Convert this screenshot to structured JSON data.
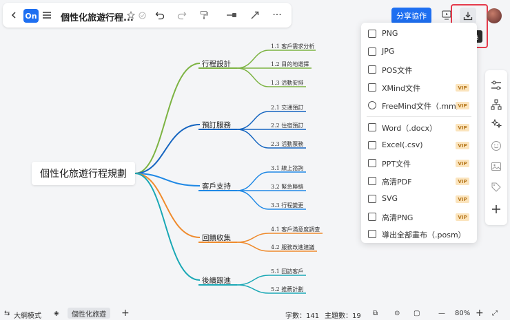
{
  "toolbar": {
    "title": "個性化旅遊行程...",
    "logo_text": "On",
    "share_label": "分享協作",
    "export_tooltip": "導出為",
    "more_label": "···"
  },
  "export_menu": {
    "items": [
      {
        "label": "PNG",
        "vip": false
      },
      {
        "label": "JPG",
        "vip": false
      },
      {
        "label": "POS文件",
        "vip": false
      },
      {
        "label": "XMind文件",
        "vip": true
      },
      {
        "label": "FreeMind文件（.mm）",
        "vip": true
      },
      {
        "label": "Word（.docx）",
        "vip": true
      },
      {
        "label": "Excel(.csv)",
        "vip": true
      },
      {
        "label": "PPT文件",
        "vip": true
      },
      {
        "label": "高清PDF",
        "vip": true
      },
      {
        "label": "SVG",
        "vip": true
      },
      {
        "label": "高清PNG",
        "vip": true
      },
      {
        "label": "導出全部畫布（.posm）",
        "vip": false
      }
    ],
    "vip_label": "VIP"
  },
  "mindmap": {
    "root": "個性化旅遊行程規劃",
    "branches": [
      {
        "label": "行程設計",
        "color": "#7cb342",
        "leaves": [
          "1.1 客戶需求分析",
          "1.2 目的地選擇",
          "1.3 活動安排"
        ]
      },
      {
        "label": "預訂服務",
        "color": "#1565c0",
        "leaves": [
          "2.1 交通預訂",
          "2.2 住宿預訂",
          "2.3 活動票務"
        ]
      },
      {
        "label": "客戶支持",
        "color": "#1e88e5",
        "leaves": [
          "3.1 線上諮詢",
          "3.2 緊急聯絡",
          "3.3 行程變更"
        ]
      },
      {
        "label": "回饋收集",
        "color": "#ef8a2c",
        "leaves": [
          "4.1 客戶滿意度調查",
          "4.2 服務改進建議"
        ]
      },
      {
        "label": "後續跟進",
        "color": "#1aa8b5",
        "leaves": [
          "5.1 回訪客戶",
          "5.2 推薦計劃"
        ]
      }
    ]
  },
  "bottombar": {
    "outline_mode": "大綱模式",
    "sheet_tab": "個性化旅遊",
    "add_label": "+",
    "word_count": "字數：141",
    "topic_count": "主題數：19",
    "zoom": "80%",
    "zoom_minus": "—",
    "zoom_plus": "+"
  }
}
